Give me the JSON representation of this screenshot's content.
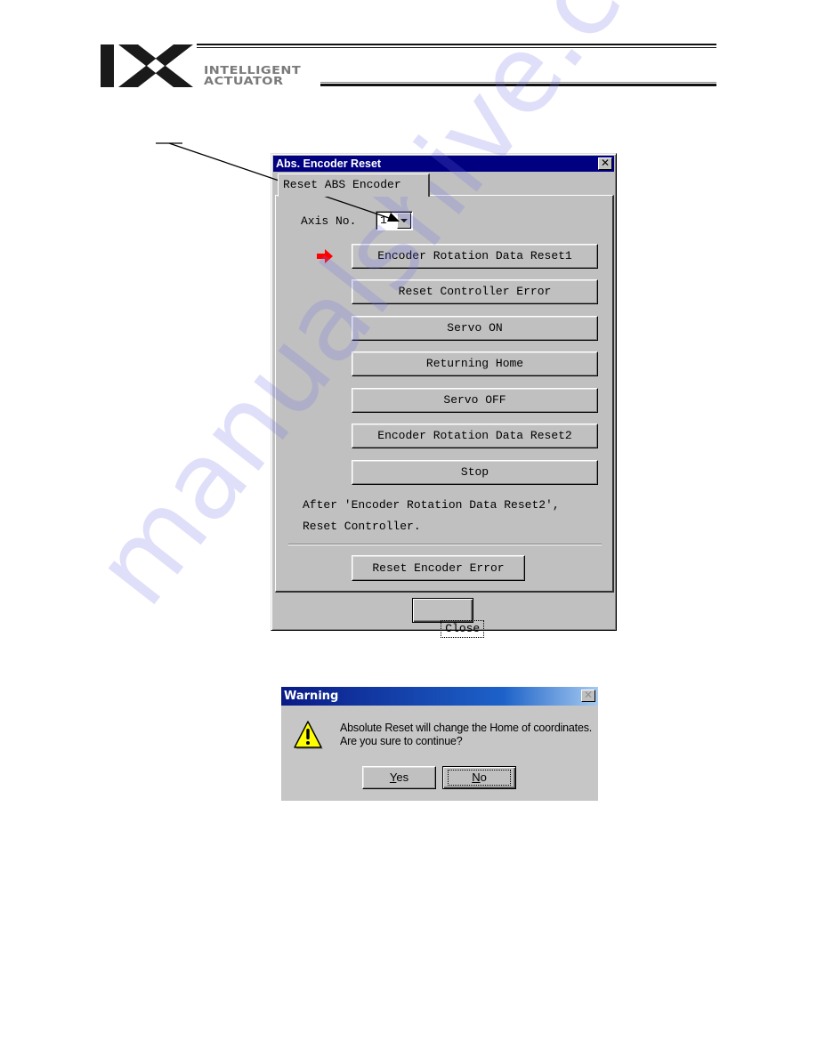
{
  "header": {
    "logo_mark": "IX",
    "brand_line1": "INTELLIGENT",
    "brand_line2": "ACTUATOR"
  },
  "abs_dialog": {
    "title": "Abs. Encoder Reset",
    "close_glyph": "✕",
    "tab_label": "Reset ABS Encoder",
    "axis_label": "Axis No.",
    "axis_value": "1",
    "buttons": [
      {
        "label": "Encoder Rotation Data Reset1",
        "highlighted": true
      },
      {
        "label": "Reset Controller Error"
      },
      {
        "label": "Servo ON"
      },
      {
        "label": "Returning Home"
      },
      {
        "label": "Servo OFF"
      },
      {
        "label": "Encoder Rotation Data Reset2"
      },
      {
        "label": "Stop"
      }
    ],
    "note_line1": "After 'Encoder Rotation Data Reset2',",
    "note_line2": "Reset Controller.",
    "reset_encoder_error": "Reset Encoder Error",
    "close_button": "Close",
    "highlight_color": "#ff0000",
    "title_color": "#000080"
  },
  "warning_dialog": {
    "title": "Warning",
    "close_glyph": "✕",
    "icon": "warning-triangle-icon",
    "message_line1": "Absolute Reset will change the Home of coordinates.",
    "message_line2": "Are you sure to continue?",
    "yes_mnemonic": "Y",
    "yes_rest": "es",
    "no_mnemonic": "N",
    "no_rest": "o"
  },
  "watermark": "manualshive.com"
}
